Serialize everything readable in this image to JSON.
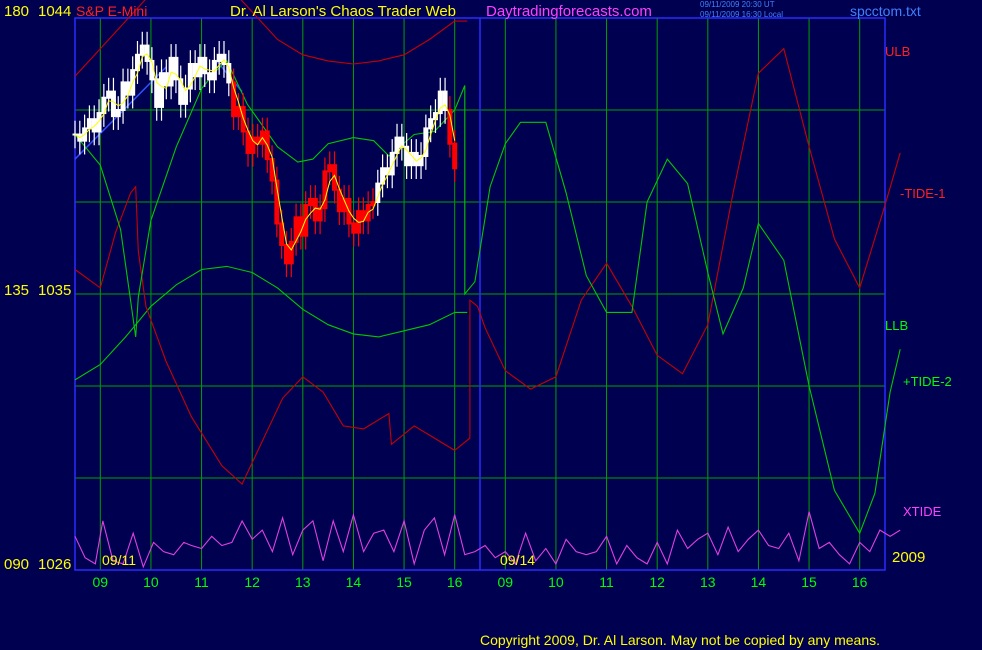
{
  "header": {
    "symbol_code": "180",
    "symbol_price": "1044",
    "instrument": "S&P E-Mini",
    "title": "Dr. Al Larson's Chaos Trader Web",
    "website": "Daytradingforecasts.com",
    "timestamp_ut": "09/11/2009 20:30 UT",
    "timestamp_local": "09/11/2009 16:30 Local",
    "file": "spcctom.txt"
  },
  "y_labels": {
    "mid_code": "135",
    "mid_price": "1035",
    "bottom_code": "090",
    "bottom_price": "1026"
  },
  "date_labels": {
    "left": "09/11",
    "middle": "09/14",
    "year": "2009"
  },
  "right_labels": {
    "ulb": "ULB",
    "tide1": "-TIDE-1",
    "llb": "LLB",
    "tide2": "+TIDE-2",
    "xtide": "XTIDE"
  },
  "footer": {
    "copyright": "Copyright 2009, Dr. Al Larson. May not be copied by any means."
  },
  "colors": {
    "background": "#000050",
    "grid": "#00a000",
    "frame": "#2a2aff",
    "ulb": "#c80000",
    "llb": "#00c800",
    "xtide": "#e040e0",
    "price_up": "#ffffff",
    "price_down": "#ff0000",
    "avg": "#ffff00",
    "trend": "#3050ff",
    "label_yellow": "#ffff00",
    "label_green": "#00ff00",
    "label_red": "#ff2020",
    "label_magenta": "#ff40ff",
    "label_blue": "#4080ff"
  },
  "chart_data": {
    "type": "line",
    "title": "S&P E-Mini",
    "ylim": [
      1026,
      1044
    ],
    "x_tick_labels": [
      "09",
      "10",
      "11",
      "12",
      "13",
      "14",
      "15",
      "16",
      "09",
      "10",
      "11",
      "12",
      "13",
      "14",
      "15",
      "16"
    ],
    "hours_left": [
      8.5,
      16.5
    ],
    "hours_right": [
      8.5,
      16.5
    ],
    "price_bars": {
      "start_hour": 8.5,
      "end_hour": 16.0,
      "close": [
        1040.2,
        1040.0,
        1040.4,
        1040.7,
        1040.3,
        1040.9,
        1041.4,
        1041.6,
        1040.8,
        1041.0,
        1041.9,
        1041.5,
        1042.3,
        1042.8,
        1043.1,
        1042.6,
        1042.0,
        1041.1,
        1042.2,
        1041.8,
        1042.7,
        1042.0,
        1041.2,
        1041.7,
        1042.5,
        1042.1,
        1042.7,
        1042.2,
        1042.0,
        1042.6,
        1042.8,
        1042.5,
        1041.9,
        1040.8,
        1041.1,
        1040.3,
        1039.6,
        1040.1,
        1039.9,
        1040.3,
        1039.4,
        1038.7,
        1037.3,
        1036.6,
        1036.0,
        1036.7,
        1037.5,
        1036.9,
        1037.9,
        1038.1,
        1037.4,
        1037.8,
        1039.0,
        1039.2,
        1038.4,
        1037.7,
        1038.1,
        1037.3,
        1037.0,
        1037.7,
        1037.4,
        1037.9,
        1038.0,
        1038.6,
        1039.1,
        1038.9,
        1039.6,
        1040.1,
        1039.8,
        1039.2,
        1039.6,
        1039.2,
        1039.5,
        1040.4,
        1040.7,
        1040.9,
        1041.6,
        1041.0,
        1039.9,
        1039.1
      ],
      "down_segments": [
        [
          33,
          62
        ],
        [
          78,
          80
        ]
      ]
    },
    "series": [
      {
        "name": "ULB",
        "label": "ULB",
        "color": "#c80000",
        "x": [
          8.5,
          9.0,
          9.5,
          10.0,
          10.5,
          11.0,
          11.5,
          12.0,
          12.5,
          13.0,
          13.5,
          14.0,
          14.5,
          15.0,
          15.5,
          16.0,
          16.25
        ],
        "y": [
          1042.1,
          1043.0,
          1043.9,
          1044.8,
          1045.6,
          1045.6,
          1045.1,
          1044.2,
          1043.3,
          1042.8,
          1042.6,
          1042.5,
          1042.6,
          1042.8,
          1043.3,
          1043.9,
          1043.9
        ]
      },
      {
        "name": "LLB",
        "label": "LLB",
        "color": "#00c800",
        "x": [
          8.5,
          9.0,
          9.5,
          10.0,
          10.5,
          11.0,
          11.5,
          12.0,
          12.5,
          13.0,
          13.5,
          14.0,
          14.5,
          15.0,
          15.5,
          16.0,
          16.25
        ],
        "y": [
          1032.2,
          1032.7,
          1033.6,
          1034.6,
          1035.3,
          1035.8,
          1035.9,
          1035.7,
          1035.2,
          1034.5,
          1034.0,
          1033.7,
          1033.6,
          1033.8,
          1034.0,
          1034.4,
          1034.4
        ]
      },
      {
        "name": "-TIDE-1",
        "label": "-TIDE-1",
        "color": "#c80000",
        "x": [
          8.5,
          9.0,
          9.3,
          9.6,
          9.7,
          9.75,
          9.9,
          10.3,
          10.8,
          11.4,
          11.8,
          12.2,
          12.6,
          13.0,
          13.4,
          13.8,
          14.2,
          14.6,
          14.7,
          14.75,
          15.2,
          15.6,
          16.0,
          16.3,
          16.3,
          16.45,
          16.6,
          17.0,
          17.5,
          18.0,
          18.5,
          19.0,
          19.5,
          20.0,
          20.5,
          21.0,
          21.5,
          22.0,
          22.5,
          23.0,
          23.5,
          24.0,
          24.5,
          24.8
        ],
        "y": [
          1035.8,
          1035.2,
          1037.0,
          1038.3,
          1038.5,
          1036.4,
          1034.6,
          1032.8,
          1031.0,
          1029.4,
          1028.8,
          1030.2,
          1031.6,
          1032.3,
          1031.8,
          1030.7,
          1030.6,
          1031.0,
          1031.1,
          1030.1,
          1030.7,
          1030.3,
          1029.9,
          1030.3,
          1034.8,
          1034.6,
          1033.9,
          1032.5,
          1031.9,
          1032.3,
          1034.8,
          1036.0,
          1034.6,
          1033.0,
          1032.4,
          1034.0,
          1038.3,
          1042.2,
          1043.0,
          1039.8,
          1036.8,
          1035.2,
          1037.9,
          1039.6
        ]
      },
      {
        "name": "+TIDE-2",
        "label": "+TIDE-2",
        "color": "#00c800",
        "x": [
          8.5,
          9.0,
          9.4,
          9.7,
          9.75,
          10.0,
          10.5,
          11.0,
          11.3,
          11.5,
          11.9,
          12.5,
          12.9,
          13.2,
          13.5,
          14.0,
          14.4,
          14.7,
          15.2,
          15.6,
          16.0,
          16.2,
          16.2,
          16.4,
          16.7,
          17.0,
          17.3,
          17.8,
          18.2,
          18.6,
          19.0,
          19.5,
          19.8,
          20.2,
          20.6,
          21.0,
          21.3,
          21.7,
          22.0,
          22.5,
          23.0,
          23.5,
          24.0,
          24.3,
          24.6,
          24.8
        ],
        "y": [
          1040.2,
          1039.2,
          1037.1,
          1033.6,
          1034.9,
          1037.4,
          1039.8,
          1041.7,
          1042.3,
          1042.6,
          1041.2,
          1039.8,
          1039.3,
          1039.4,
          1039.9,
          1040.1,
          1040.0,
          1039.5,
          1040.2,
          1040.3,
          1041.0,
          1041.8,
          1035.0,
          1035.4,
          1038.5,
          1039.9,
          1040.6,
          1040.6,
          1038.3,
          1035.6,
          1034.4,
          1034.4,
          1038.0,
          1039.4,
          1038.6,
          1035.7,
          1033.7,
          1035.2,
          1037.3,
          1036.1,
          1032.0,
          1028.6,
          1027.2,
          1028.5,
          1031.8,
          1033.2
        ]
      },
      {
        "name": "XTIDE",
        "label": "XTIDE",
        "color": "#e040e0",
        "x": [
          8.5,
          8.7,
          8.9,
          9.05,
          9.25,
          9.45,
          9.65,
          9.85,
          10.05,
          10.25,
          10.45,
          10.65,
          10.8,
          11.0,
          11.2,
          11.4,
          11.6,
          11.8,
          12.0,
          12.2,
          12.4,
          12.6,
          12.8,
          13.0,
          13.2,
          13.4,
          13.6,
          13.8,
          14.0,
          14.2,
          14.4,
          14.6,
          14.8,
          15.0,
          15.2,
          15.4,
          15.6,
          15.8,
          16.0,
          16.2,
          16.4,
          16.6,
          16.8,
          17.0,
          17.2,
          17.4,
          17.6,
          17.8,
          18.0,
          18.2,
          18.4,
          18.6,
          18.8,
          19.0,
          19.2,
          19.4,
          19.6,
          19.8,
          20.0,
          20.2,
          20.4,
          20.6,
          20.8,
          21.0,
          21.2,
          21.4,
          21.6,
          21.8,
          22.0,
          22.2,
          22.4,
          22.6,
          22.8,
          23.0,
          23.2,
          23.4,
          23.6,
          23.8,
          24.0,
          24.2,
          24.4,
          24.6,
          24.8
        ],
        "y": [
          1027.1,
          1026.4,
          1026.2,
          1027.6,
          1026.3,
          1026.2,
          1027.2,
          1026.1,
          1026.9,
          1026.6,
          1026.5,
          1026.9,
          1026.8,
          1026.7,
          1027.1,
          1026.8,
          1026.9,
          1027.6,
          1027.0,
          1027.3,
          1026.6,
          1027.7,
          1026.5,
          1027.3,
          1027.6,
          1026.3,
          1027.6,
          1026.6,
          1027.8,
          1026.6,
          1027.2,
          1027.3,
          1026.6,
          1027.6,
          1026.2,
          1027.3,
          1027.7,
          1026.5,
          1027.8,
          1026.5,
          1026.6,
          1026.8,
          1026.4,
          1026.6,
          1026.2,
          1027.2,
          1026.3,
          1026.7,
          1026.2,
          1027.0,
          1026.6,
          1026.5,
          1026.6,
          1027.1,
          1026.2,
          1026.8,
          1026.4,
          1026.2,
          1026.9,
          1026.2,
          1027.3,
          1026.7,
          1027.0,
          1027.2,
          1026.5,
          1027.4,
          1026.6,
          1027.0,
          1027.3,
          1026.8,
          1026.7,
          1027.2,
          1026.3,
          1027.9,
          1026.7,
          1026.9,
          1026.5,
          1026.2,
          1026.9,
          1026.6,
          1027.3,
          1027.1,
          1027.3
        ]
      }
    ],
    "grid": true
  }
}
